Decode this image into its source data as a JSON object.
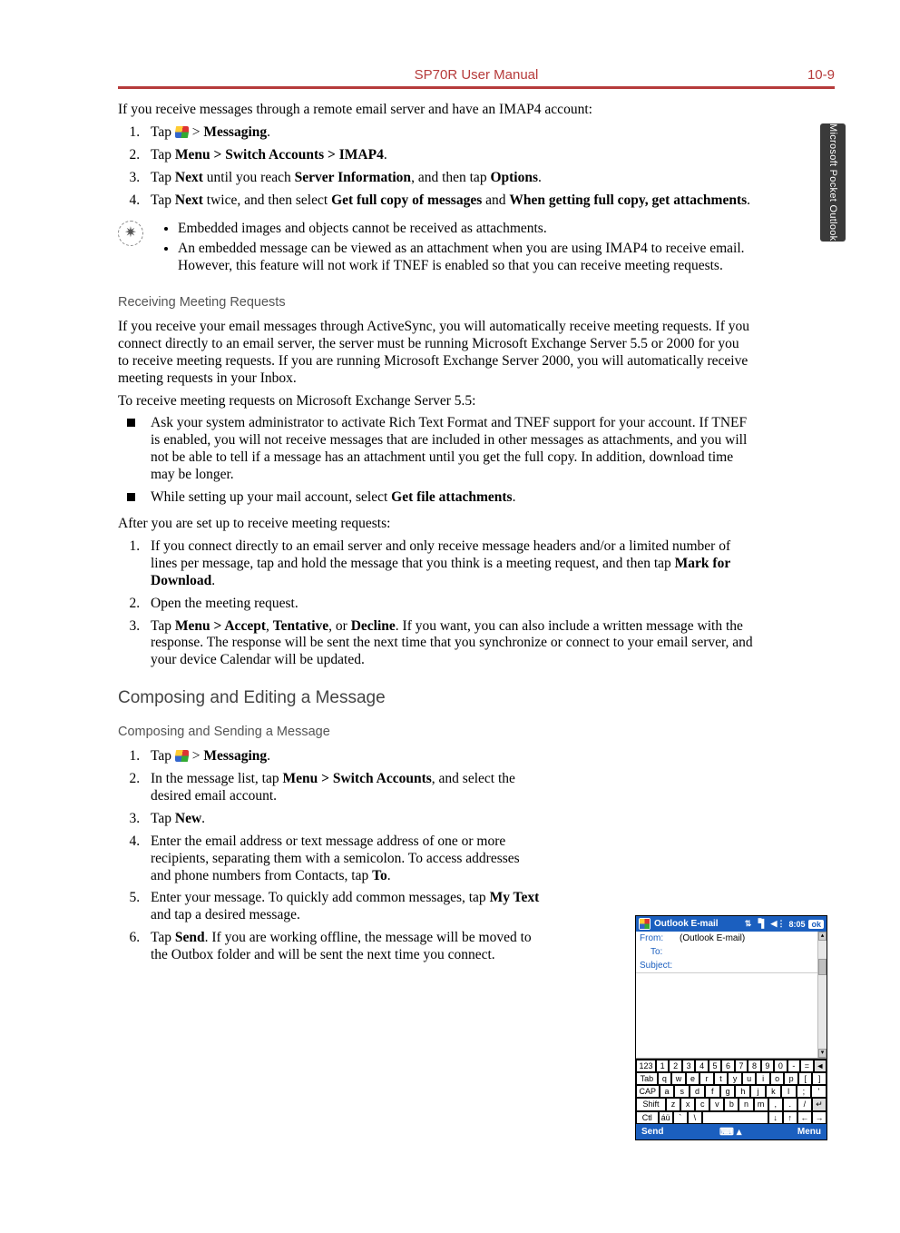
{
  "header": {
    "title": "SP70R User Manual",
    "page_number": "10-9"
  },
  "side_tab": "Microsoft Pocket Outlook",
  "intro_imap": "If you receive messages through a remote email server and have an IMAP4 account:",
  "imap_steps": {
    "s1a": "Tap ",
    "s1b": " > ",
    "s1c": "Messaging",
    "s1d": ".",
    "s2a": "Tap ",
    "s2b": "Menu > Switch Accounts > IMAP4",
    "s2c": ".",
    "s3a": "Tap ",
    "s3b": "Next",
    "s3c": " until you reach ",
    "s3d": "Server Information",
    "s3e": ", and then tap ",
    "s3f": "Options",
    "s3g": ".",
    "s4a": "Tap ",
    "s4b": "Next",
    "s4c": " twice, and then select ",
    "s4d": "Get full copy of messages",
    "s4e": " and ",
    "s4f": "When getting full copy, get attachments",
    "s4g": "."
  },
  "tips": {
    "t1": "Embedded images and objects cannot be received as attachments.",
    "t2": "An embedded message can be viewed as an attachment when you are using IMAP4 to receive email. However, this feature will not work if TNEF is enabled so that you can receive meeting requests."
  },
  "recv_heading": "Receiving Meeting Requests",
  "recv_p1": "If you receive your email messages through ActiveSync, you will automatically receive meeting requests. If you connect directly to an email server, the server must be running Microsoft Exchange Server 5.5 or 2000 for you to receive meeting requests. If you are running Microsoft Exchange Server 2000, you will automatically receive meeting requests in your Inbox.",
  "recv_p2": "To receive meeting requests on Microsoft Exchange Server 5.5:",
  "recv_bullets": {
    "b1": "Ask your system administrator to activate Rich Text Format and TNEF support for your account. If TNEF is enabled, you will not receive messages that are included in other messages as attachments, and you will not be able to tell if a message has an attachment until you get the full copy. In addition, download time may be longer.",
    "b2a": "While setting up your mail account, select ",
    "b2b": "Get file attachments",
    "b2c": "."
  },
  "recv_after": "After you are set up to receive meeting requests:",
  "recv_steps": {
    "r1a": "If you connect directly to an email server and only receive message headers and/or a limited number of lines per message, tap and hold the message that you think is a meeting request, and then tap ",
    "r1b": "Mark for Download",
    "r1c": ".",
    "r2": "Open the meeting request.",
    "r3a": "Tap ",
    "r3b": "Menu > Accept",
    "r3c": ", ",
    "r3d": "Tentative",
    "r3e": ", or ",
    "r3f": "Decline",
    "r3g": ". If you want, you can also include a written message with the response. The response will be sent the next time that you synchronize or connect to your email server, and your device Calendar will be updated."
  },
  "compose_heading": "Composing and Editing a Message",
  "compose_sub": "Composing and Sending a Message",
  "compose_steps": {
    "c1a": "Tap ",
    "c1b": " > ",
    "c1c": "Messaging",
    "c1d": ".",
    "c2a": "In the message list, tap ",
    "c2b": "Menu > Switch Accounts",
    "c2c": ", and select the desired email account.",
    "c3a": "Tap ",
    "c3b": "New",
    "c3c": ".",
    "c4a": "Enter the email address or text message address of one or more recipients, separating them with a semicolon. To access addresses and phone numbers from Contacts, tap ",
    "c4b": "To",
    "c4c": ".",
    "c5a": "Enter your message. To quickly add common messages, tap ",
    "c5b": "My Text",
    "c5c": " and tap a desired message.",
    "c6a": "Tap ",
    "c6b": "Send",
    "c6c": ". If you are working offline, the message will be moved to the Outbox folder and will be sent the next time you connect."
  },
  "device": {
    "title": "Outlook E-mail",
    "time": "8:05",
    "ok": "ok",
    "from_lbl": "From:",
    "from_val": "(Outlook E-mail)",
    "to_lbl": "To:",
    "subject_lbl": "Subject:",
    "send": "Send",
    "menu": "Menu",
    "rows": {
      "r1": [
        "123",
        "1",
        "2",
        "3",
        "4",
        "5",
        "6",
        "7",
        "8",
        "9",
        "0",
        "-",
        "=",
        "◄"
      ],
      "r2": [
        "Tab",
        "q",
        "w",
        "e",
        "r",
        "t",
        "y",
        "u",
        "i",
        "o",
        "p",
        "[",
        "]"
      ],
      "r3": [
        "CAP",
        "a",
        "s",
        "d",
        "f",
        "g",
        "h",
        "j",
        "k",
        "l",
        ";",
        "'"
      ],
      "r4": [
        "Shift",
        "z",
        "x",
        "c",
        "v",
        "b",
        "n",
        "m",
        ",",
        ".",
        "/",
        "↵"
      ],
      "r5": [
        "Ctl",
        "áü",
        "`",
        "\\",
        " ",
        "↓",
        "↑",
        "←",
        "→"
      ]
    }
  }
}
